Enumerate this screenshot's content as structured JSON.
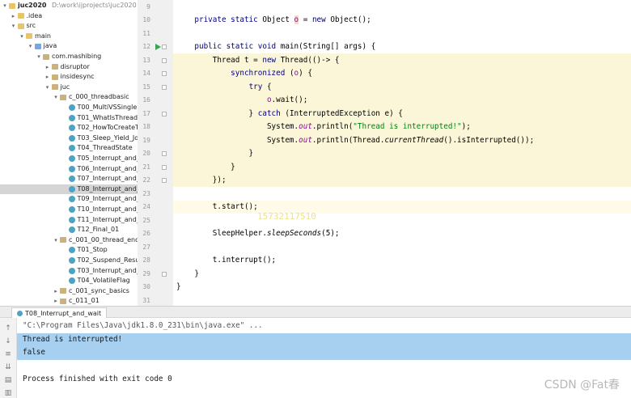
{
  "tree": [
    {
      "label": "juc2020",
      "path": "D:\\work\\ijprojects\\juc2020",
      "depth": 0,
      "arrow": "open",
      "icon": "folder",
      "bold": true
    },
    {
      "label": ".idea",
      "depth": 1,
      "arrow": "closed",
      "icon": "folder"
    },
    {
      "label": "src",
      "depth": 1,
      "arrow": "open",
      "icon": "folder"
    },
    {
      "label": "main",
      "depth": 2,
      "arrow": "open",
      "icon": "folder"
    },
    {
      "label": "java",
      "depth": 3,
      "arrow": "open",
      "icon": "srcf"
    },
    {
      "label": "com.mashibing",
      "depth": 4,
      "arrow": "open",
      "icon": "pkg"
    },
    {
      "label": "disruptor",
      "depth": 5,
      "arrow": "closed",
      "icon": "pkg"
    },
    {
      "label": "insidesync",
      "depth": 5,
      "arrow": "closed",
      "icon": "pkg"
    },
    {
      "label": "juc",
      "depth": 5,
      "arrow": "open",
      "icon": "pkg"
    },
    {
      "label": "c_000_threadbasic",
      "depth": 6,
      "arrow": "open",
      "icon": "pkg"
    },
    {
      "label": "T00_MultiVSSingle",
      "depth": 7,
      "icon": "cls"
    },
    {
      "label": "T01_WhatIsThread",
      "depth": 7,
      "icon": "cls"
    },
    {
      "label": "T02_HowToCreateThread",
      "depth": 7,
      "icon": "cls"
    },
    {
      "label": "T03_Sleep_Yield_Join",
      "depth": 7,
      "icon": "cls"
    },
    {
      "label": "T04_ThreadState",
      "depth": 7,
      "icon": "cls"
    },
    {
      "label": "T05_Interrupt_and_isInterrupted",
      "depth": 7,
      "icon": "cls"
    },
    {
      "label": "T06_Interrupt_and_interrupted",
      "depth": 7,
      "icon": "cls"
    },
    {
      "label": "T07_Interrupt_and_sleep",
      "depth": 7,
      "icon": "cls"
    },
    {
      "label": "T08_Interrupt_and_wait",
      "depth": 7,
      "icon": "cls",
      "selected": true
    },
    {
      "label": "T09_Interrupt_and_sync",
      "depth": 7,
      "icon": "cls"
    },
    {
      "label": "T10_Interrupt_and_lock",
      "depth": 7,
      "icon": "cls"
    },
    {
      "label": "T11_Interrupt_and_lockInterruptibly",
      "depth": 7,
      "icon": "cls"
    },
    {
      "label": "T12_Final_01",
      "depth": 7,
      "icon": "cls"
    },
    {
      "label": "c_001_00_thread_end",
      "depth": 6,
      "arrow": "open",
      "icon": "pkg"
    },
    {
      "label": "T01_Stop",
      "depth": 7,
      "icon": "cls"
    },
    {
      "label": "T02_Suspend_Resume",
      "depth": 7,
      "icon": "cls"
    },
    {
      "label": "T03_Interrupt_and_NormalThread",
      "depth": 7,
      "icon": "cls"
    },
    {
      "label": "T04_VolatileFlag",
      "depth": 7,
      "icon": "cls"
    },
    {
      "label": "c_001_sync_basics",
      "depth": 6,
      "arrow": "closed",
      "icon": "pkg"
    },
    {
      "label": "c_011_01",
      "depth": 6,
      "arrow": "closed",
      "icon": "pkg"
    }
  ],
  "editor": {
    "lines": [
      {
        "num": "9",
        "parts": []
      },
      {
        "num": "10",
        "parts": [
          {
            "t": "    "
          },
          {
            "t": "private static ",
            "c": "kw"
          },
          {
            "t": "Object "
          },
          {
            "t": "o",
            "c": "fld hlv"
          },
          {
            "t": " = "
          },
          {
            "t": "new ",
            "c": "kw"
          },
          {
            "t": "Object();"
          }
        ]
      },
      {
        "num": "11",
        "parts": []
      },
      {
        "num": "12",
        "run": true,
        "fold": true,
        "parts": [
          {
            "t": "    "
          },
          {
            "t": "public static void ",
            "c": "kw"
          },
          {
            "t": "main(String[] args) {"
          }
        ]
      },
      {
        "num": "13",
        "fold": true,
        "parts": [
          {
            "t": "        Thread t = "
          },
          {
            "t": "new ",
            "c": "kw"
          },
          {
            "t": "Thread(()-> {"
          }
        ]
      },
      {
        "num": "14",
        "fold": true,
        "parts": [
          {
            "t": "            "
          },
          {
            "t": "synchronized ",
            "c": "kw"
          },
          {
            "t": "("
          },
          {
            "t": "o",
            "c": "fld"
          },
          {
            "t": ") {"
          }
        ]
      },
      {
        "num": "15",
        "fold": true,
        "parts": [
          {
            "t": "                "
          },
          {
            "t": "try ",
            "c": "kw"
          },
          {
            "t": "{"
          }
        ]
      },
      {
        "num": "16",
        "parts": [
          {
            "t": "                    "
          },
          {
            "t": "o",
            "c": "fld"
          },
          {
            "t": ".wait();"
          }
        ]
      },
      {
        "num": "17",
        "fold": true,
        "parts": [
          {
            "t": "                } "
          },
          {
            "t": "catch ",
            "c": "kw"
          },
          {
            "t": "(InterruptedException e) {"
          }
        ]
      },
      {
        "num": "18",
        "parts": [
          {
            "t": "                    System."
          },
          {
            "t": "out",
            "c": "fld it"
          },
          {
            "t": ".println("
          },
          {
            "t": "\"Thread is interrupted!\"",
            "c": "str"
          },
          {
            "t": ");"
          }
        ]
      },
      {
        "num": "19",
        "parts": [
          {
            "t": "                    System."
          },
          {
            "t": "out",
            "c": "fld it"
          },
          {
            "t": ".println(Thread."
          },
          {
            "t": "currentThread",
            "c": "it"
          },
          {
            "t": "().isInterrupted());"
          }
        ]
      },
      {
        "num": "20",
        "fold": true,
        "parts": [
          {
            "t": "                }"
          }
        ]
      },
      {
        "num": "21",
        "fold": true,
        "parts": [
          {
            "t": "            }"
          }
        ]
      },
      {
        "num": "22",
        "fold": true,
        "parts": [
          {
            "t": "        });"
          }
        ]
      },
      {
        "num": "23",
        "parts": []
      },
      {
        "num": "24",
        "parts": [
          {
            "t": "        t.start();"
          }
        ]
      },
      {
        "num": "25",
        "parts": []
      },
      {
        "num": "26",
        "parts": [
          {
            "t": "        SleepHelper."
          },
          {
            "t": "sleepSeconds",
            "c": "it"
          },
          {
            "t": "(5);"
          }
        ]
      },
      {
        "num": "27",
        "parts": []
      },
      {
        "num": "28",
        "parts": [
          {
            "t": "        t.interrupt();"
          }
        ]
      },
      {
        "num": "29",
        "fold": true,
        "parts": [
          {
            "t": "    }"
          }
        ]
      },
      {
        "num": "30",
        "parts": [
          {
            "t": "}"
          }
        ]
      },
      {
        "num": "31",
        "parts": []
      }
    ],
    "watermark": "15732117510"
  },
  "run_panel": {
    "tab_label": "T08_Interrupt_and_wait",
    "lines": [
      {
        "text": "\"C:\\Program Files\\Java\\jdk1.8.0_231\\bin\\java.exe\" ...",
        "kind": "cmd"
      },
      {
        "text": "Thread is interrupted!",
        "kind": "out",
        "selected": true
      },
      {
        "text": "false",
        "kind": "out",
        "selected": true
      },
      {
        "text": "",
        "kind": "out"
      },
      {
        "text": "Process finished with exit code 0",
        "kind": "out"
      }
    ],
    "tools": [
      "up-arrow-icon",
      "down-arrow-icon",
      "wrap-icon",
      "scroll-end-icon",
      "print-icon",
      "trash-icon"
    ]
  },
  "watermark_csdn": "CSDN @Fat春",
  "colors": {
    "lambda_bg": "#fcf6d8",
    "selection": "#a6cff0",
    "keyword": "#000080",
    "string": "#067d17",
    "field": "#871094"
  }
}
